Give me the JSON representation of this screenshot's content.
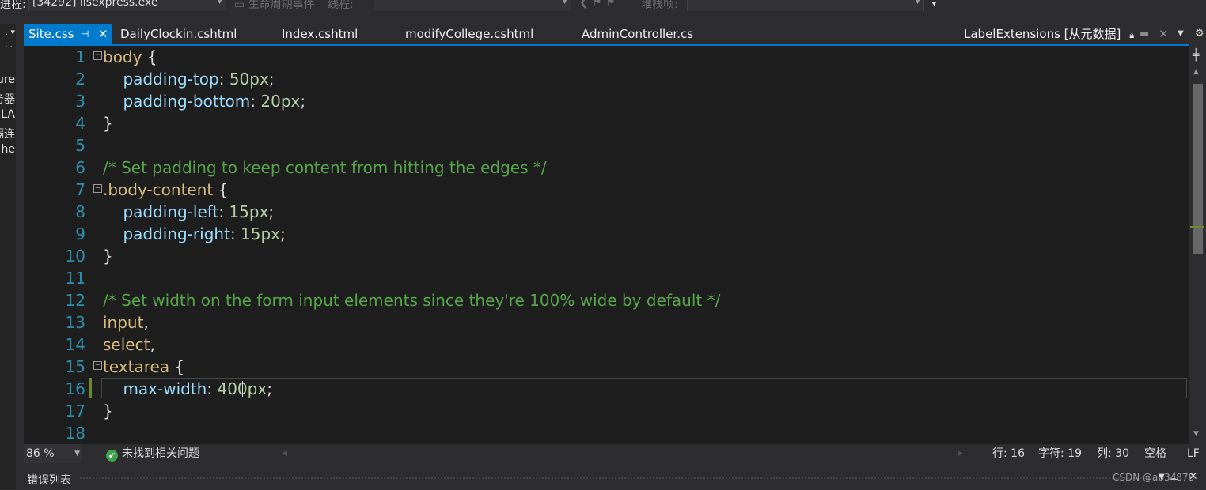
{
  "toolbar": {
    "process_label": "进程:",
    "process_value": "[34292] iisexpress.exe",
    "lifecycle_label": "生命周期事件",
    "thread_label": "线程:",
    "stackframe_label": "堆栈帧:"
  },
  "left_panel": {
    "items": [
      "ure",
      "务器",
      "LA",
      "隔连",
      "he"
    ]
  },
  "tabs": [
    {
      "label": "Site.css",
      "active": true
    },
    {
      "label": "DailyClockin.cshtml",
      "active": false
    },
    {
      "label": "Index.cshtml",
      "active": false
    },
    {
      "label": "modifyCollege.cshtml",
      "active": false
    },
    {
      "label": "AdminController.cs",
      "active": false
    },
    {
      "label": "LabelExtensions [从元数据]",
      "active": false
    }
  ],
  "code_lines": [
    {
      "n": "1",
      "fold": "−",
      "tokens": [
        {
          "t": "body",
          "c": "sel"
        },
        {
          "t": " {",
          "c": "punc"
        }
      ]
    },
    {
      "n": "2",
      "guide": true,
      "tokens": [
        {
          "t": "    "
        },
        {
          "t": "padding-top",
          "c": "prop"
        },
        {
          "t": ": ",
          "c": "punc"
        },
        {
          "t": "50px",
          "c": "val"
        },
        {
          "t": ";",
          "c": "punc"
        }
      ]
    },
    {
      "n": "3",
      "guide": true,
      "tokens": [
        {
          "t": "    "
        },
        {
          "t": "padding-bottom",
          "c": "prop"
        },
        {
          "t": ": ",
          "c": "punc"
        },
        {
          "t": "20px",
          "c": "val"
        },
        {
          "t": ";",
          "c": "punc"
        }
      ]
    },
    {
      "n": "4",
      "guide": true,
      "tokens": [
        {
          "t": "}",
          "c": "punc"
        }
      ]
    },
    {
      "n": "5",
      "tokens": []
    },
    {
      "n": "6",
      "tokens": [
        {
          "t": "/* Set padding to keep content from hitting the edges */",
          "c": "cmt"
        }
      ]
    },
    {
      "n": "7",
      "fold": "−",
      "tokens": [
        {
          "t": ".body-content",
          "c": "sel"
        },
        {
          "t": " {",
          "c": "punc"
        }
      ]
    },
    {
      "n": "8",
      "guide": true,
      "tokens": [
        {
          "t": "    "
        },
        {
          "t": "padding-left",
          "c": "prop"
        },
        {
          "t": ": ",
          "c": "punc"
        },
        {
          "t": "15px",
          "c": "val"
        },
        {
          "t": ";",
          "c": "punc"
        }
      ]
    },
    {
      "n": "9",
      "guide": true,
      "tokens": [
        {
          "t": "    "
        },
        {
          "t": "padding-right",
          "c": "prop"
        },
        {
          "t": ": ",
          "c": "punc"
        },
        {
          "t": "15px",
          "c": "val"
        },
        {
          "t": ";",
          "c": "punc"
        }
      ]
    },
    {
      "n": "10",
      "guide": true,
      "tokens": [
        {
          "t": "}",
          "c": "punc"
        }
      ]
    },
    {
      "n": "11",
      "tokens": []
    },
    {
      "n": "12",
      "tokens": [
        {
          "t": "/* Set width on the form input elements since they're 100% wide by default */",
          "c": "cmt"
        }
      ]
    },
    {
      "n": "13",
      "tokens": [
        {
          "t": "input",
          "c": "sel"
        },
        {
          "t": ",",
          "c": "punc"
        }
      ]
    },
    {
      "n": "14",
      "tokens": [
        {
          "t": "select",
          "c": "sel"
        },
        {
          "t": ",",
          "c": "punc"
        }
      ]
    },
    {
      "n": "15",
      "fold": "−",
      "tokens": [
        {
          "t": "textarea",
          "c": "sel"
        },
        {
          "t": " {",
          "c": "punc"
        }
      ]
    },
    {
      "n": "16",
      "guide": true,
      "tokens": [
        {
          "t": "    "
        },
        {
          "t": "max-width",
          "c": "prop"
        },
        {
          "t": ": ",
          "c": "punc"
        },
        {
          "t": "400px",
          "c": "val"
        },
        {
          "t": ";",
          "c": "punc"
        }
      ]
    },
    {
      "n": "17",
      "guide": true,
      "tokens": [
        {
          "t": "}",
          "c": "punc"
        }
      ]
    },
    {
      "n": "18",
      "tokens": []
    }
  ],
  "status": {
    "zoom": "86 %",
    "issues": "未找到相关问题",
    "line": "行: 16",
    "char": "字符: 19",
    "col": "列: 30",
    "whitespace": "空格",
    "eol": "LF"
  },
  "bottom_panel": {
    "title": "错误列表",
    "watermark": "CSDN @ab34878"
  },
  "colors": {
    "accent": "#007acc",
    "editor_bg": "#1e1e1e",
    "selector": "#d7ba7d",
    "property": "#9cdcfe",
    "value": "#b5cea8",
    "comment": "#57a64a",
    "line_number": "#2b91af",
    "ok_green": "#3fa34d"
  }
}
